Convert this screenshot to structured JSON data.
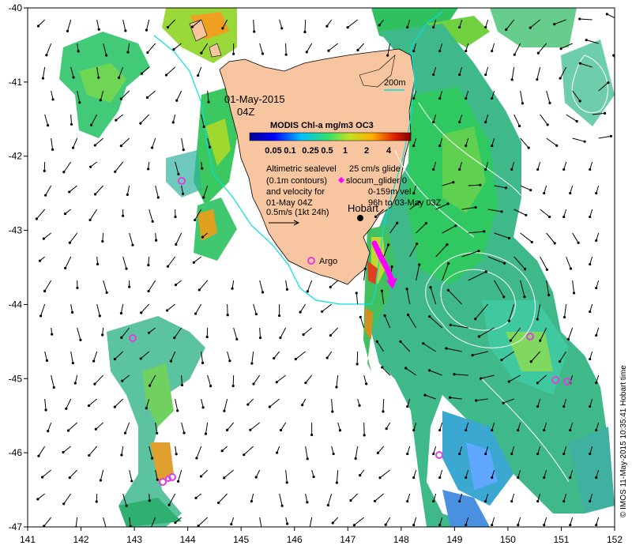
{
  "map": {
    "date": "01-May-2015",
    "time": "04Z",
    "bathy_label": "200m",
    "chl": {
      "title": "MODIS Chl-a mg/m3 OC3",
      "ticks": [
        "0.05",
        "0.1",
        "0.25",
        "0.5",
        "1",
        "2",
        "4"
      ]
    },
    "altimetry": {
      "line1": "Altimetric sealevel",
      "line2": "(0.1m contours)",
      "line3": "and velocity for",
      "line4": "01-May 04Z",
      "scale": "0.5m/s (1kt 24h)"
    },
    "glider": {
      "speed": "25 cm/s glide",
      "name": "slocum_glider 0",
      "depth": "0-159m vel",
      "period": "96h to 03-May 03Z"
    },
    "places": {
      "hobart": "Hobart",
      "argo": "Argo"
    },
    "credit": "© IMOS 11-May-2015 10:35:41 Hobart time",
    "x_ticks": [
      "141",
      "142",
      "143",
      "144",
      "145",
      "146",
      "147",
      "148",
      "149",
      "150",
      "151",
      "152"
    ],
    "y_ticks": [
      "-40",
      "-41",
      "-42",
      "-43",
      "-44",
      "-45",
      "-46",
      "-47"
    ],
    "colors": {
      "land": "#f7c59f",
      "argo_marker": "#e040e0",
      "glider_track": "#ff00ff",
      "bathy_contour": "#00e0e0",
      "arrow": "#000000"
    }
  }
}
